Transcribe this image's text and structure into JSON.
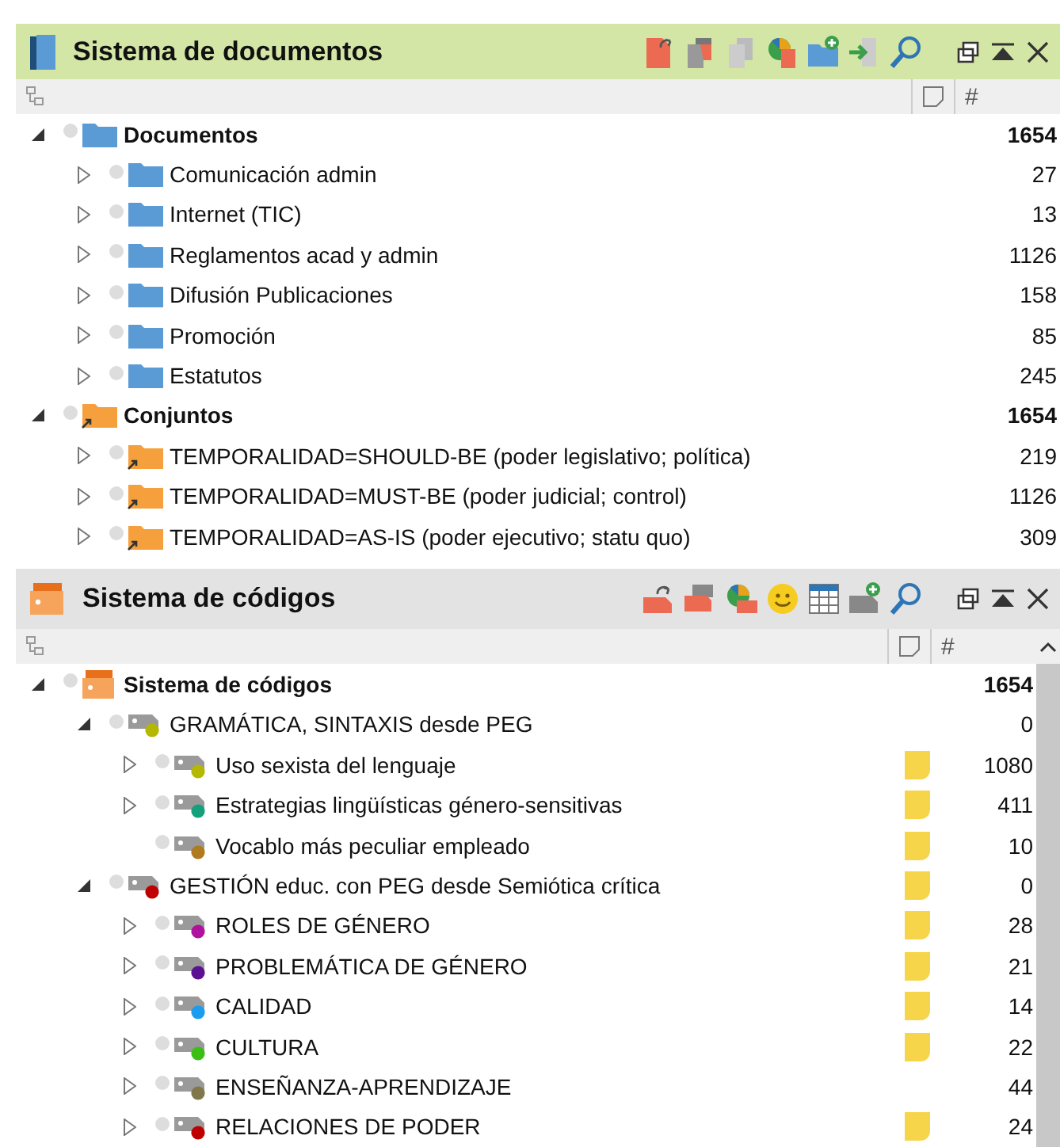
{
  "documents_panel": {
    "title": "Sistema de documentos",
    "count_header": "#",
    "tree": [
      {
        "label": "Documentos",
        "count": "1654",
        "kind": "doc-root",
        "has_children": true,
        "expanded": true,
        "children": [
          {
            "label": "Comunicación admin",
            "count": "27",
            "kind": "folder",
            "has_children": true,
            "expanded": false
          },
          {
            "label": "Internet (TIC)",
            "count": "13",
            "kind": "folder",
            "has_children": true,
            "expanded": false
          },
          {
            "label": "Reglamentos acad y admin",
            "count": "1126",
            "kind": "folder",
            "has_children": true,
            "expanded": false
          },
          {
            "label": "Difusión Publicaciones",
            "count": "158",
            "kind": "folder",
            "has_children": true,
            "expanded": false
          },
          {
            "label": "Promoción",
            "count": "85",
            "kind": "folder",
            "has_children": true,
            "expanded": false
          },
          {
            "label": "Estatutos",
            "count": "245",
            "kind": "folder",
            "has_children": true,
            "expanded": false
          }
        ]
      },
      {
        "label": "Conjuntos",
        "count": "1654",
        "kind": "set-root",
        "has_children": true,
        "expanded": true,
        "children": [
          {
            "label": "TEMPORALIDAD=SHOULD-BE (poder legislativo; política)",
            "count": "219",
            "kind": "set",
            "has_children": true,
            "expanded": false
          },
          {
            "label": "TEMPORALIDAD=MUST-BE (poder judicial; control)",
            "count": "1126",
            "kind": "set",
            "has_children": true,
            "expanded": false
          },
          {
            "label": "TEMPORALIDAD=AS-IS (poder ejecutivo; statu quo)",
            "count": "309",
            "kind": "set",
            "has_children": true,
            "expanded": false
          }
        ]
      }
    ]
  },
  "codes_panel": {
    "title": "Sistema de códigos",
    "count_header": "#",
    "tree": [
      {
        "label": "Sistema de códigos",
        "count": "1654",
        "kind": "code-root",
        "has_children": true,
        "expanded": true,
        "memo": false,
        "children": [
          {
            "label": "GRAMÁTICA, SINTAXIS desde PEG",
            "count": "0",
            "kind": "code",
            "color": "#b5b800",
            "has_children": true,
            "expanded": true,
            "memo": false,
            "children": [
              {
                "label": "Uso sexista del lenguaje",
                "count": "1080",
                "kind": "code",
                "color": "#b5b800",
                "has_children": true,
                "expanded": false,
                "memo": true
              },
              {
                "label": "Estrategias lingüísticas género-sensitivas",
                "count": "411",
                "kind": "code",
                "color": "#14a07a",
                "has_children": true,
                "expanded": false,
                "memo": true
              },
              {
                "label": "Vocablo más peculiar empleado",
                "count": "10",
                "kind": "code",
                "color": "#b07a1e",
                "has_children": false,
                "expanded": false,
                "memo": true
              }
            ]
          },
          {
            "label": "GESTIÓN educ. con PEG desde Semiótica crítica",
            "count": "0",
            "kind": "code",
            "color": "#c00000",
            "has_children": true,
            "expanded": true,
            "memo": true,
            "children": [
              {
                "label": "ROLES DE GÉNERO",
                "count": "28",
                "kind": "code",
                "color": "#b0119e",
                "has_children": true,
                "expanded": false,
                "memo": true
              },
              {
                "label": "PROBLEMÁTICA DE GÉNERO",
                "count": "21",
                "kind": "code",
                "color": "#5c1092",
                "has_children": true,
                "expanded": false,
                "memo": true
              },
              {
                "label": "CALIDAD",
                "count": "14",
                "kind": "code",
                "color": "#1a9cf0",
                "has_children": true,
                "expanded": false,
                "memo": true
              },
              {
                "label": "CULTURA",
                "count": "22",
                "kind": "code",
                "color": "#3cbf14",
                "has_children": true,
                "expanded": false,
                "memo": true
              },
              {
                "label": "ENSEÑANZA-APRENDIZAJE",
                "count": "44",
                "kind": "code",
                "color": "#80784a",
                "has_children": true,
                "expanded": false,
                "memo": false
              },
              {
                "label": "RELACIONES DE PODER",
                "count": "24",
                "kind": "code",
                "color": "#c00000",
                "has_children": true,
                "expanded": false,
                "memo": true
              }
            ]
          }
        ]
      }
    ]
  }
}
